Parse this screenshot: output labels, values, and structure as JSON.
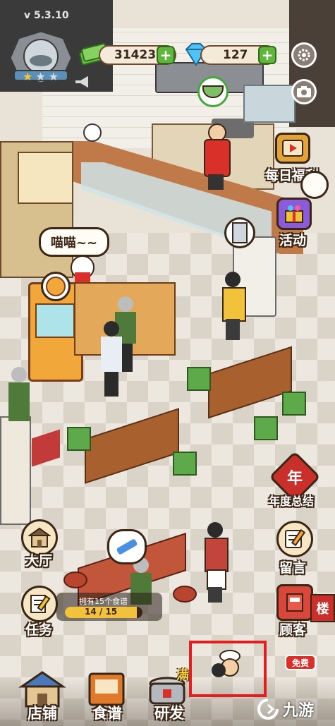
{
  "version": "v 5.3.10",
  "currency": {
    "coins": "31423",
    "gems": "127"
  },
  "bubbles": {
    "cat": "喵喵~~"
  },
  "right_menu": [
    {
      "label": "每日福利",
      "icon": "video-reward-icon"
    },
    {
      "label": "活动",
      "icon": "gift-box-icon"
    },
    {
      "label": "年度总结",
      "icon": "year-badge-icon",
      "badge": "年"
    },
    {
      "label": "留言",
      "icon": "message-pen-icon"
    },
    {
      "label": "顾客",
      "icon": "customer-book-icon"
    }
  ],
  "left_menu": [
    {
      "label": "大厅",
      "icon": "hall-building-icon"
    },
    {
      "label": "任务",
      "icon": "task-note-icon"
    }
  ],
  "recipe_progress": {
    "text": "拥有15个食谱",
    "count": "14 / 15",
    "fraction": 0.933
  },
  "bottom_nav": [
    {
      "label": "店铺",
      "icon": "shop-house-icon"
    },
    {
      "label": "食谱",
      "icon": "recipe-book-icon"
    },
    {
      "label": "研发",
      "icon": "cooking-pot-icon",
      "badge": "满"
    },
    {
      "label": "",
      "icon": "chef-icon"
    }
  ],
  "free_tag": "免费",
  "sign": {
    "text": "楼"
  },
  "watermark": "九游",
  "colors": {
    "highlight": "#e02020",
    "coin_green": "#5fb63a",
    "gem_blue": "#4fc3f7"
  }
}
